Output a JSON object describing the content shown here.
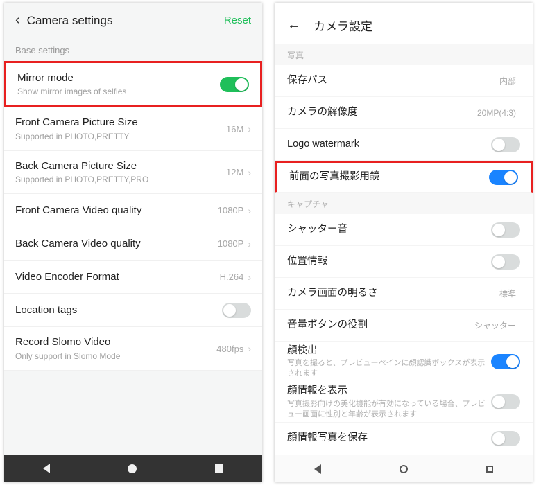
{
  "left": {
    "header": {
      "title": "Camera settings",
      "reset": "Reset"
    },
    "section": "Base settings",
    "rows": {
      "mirror": {
        "title": "Mirror mode",
        "sub": "Show mirror images of selfies"
      },
      "front_size": {
        "title": "Front Camera Picture Size",
        "sub": "Supported in PHOTO,PRETTY",
        "value": "16M"
      },
      "back_size": {
        "title": "Back Camera Picture Size",
        "sub": "Supported in PHOTO,PRETTY,PRO",
        "value": "12M"
      },
      "front_video": {
        "title": "Front Camera Video quality",
        "value": "1080P"
      },
      "back_video": {
        "title": "Back Camera Video quality",
        "value": "1080P"
      },
      "encoder": {
        "title": "Video Encoder Format",
        "value": "H.264"
      },
      "location": {
        "title": "Location tags"
      },
      "slomo": {
        "title": "Record Slomo Video",
        "sub": "Only support in Slomo Mode",
        "value": "480fps"
      }
    }
  },
  "right": {
    "header": {
      "title": "カメラ設定"
    },
    "sec_photo": "写真",
    "sec_capture": "キャプチャ",
    "rows": {
      "save_path": {
        "title": "保存パス",
        "value": "内部"
      },
      "resolution": {
        "title": "カメラの解像度",
        "value": "20MP(4:3)"
      },
      "watermark": {
        "title": "Logo watermark"
      },
      "mirror": {
        "title": "前面の写真撮影用鏡"
      },
      "shutter": {
        "title": "シャッター音"
      },
      "location": {
        "title": "位置情報"
      },
      "brightness": {
        "title": "カメラ画面の明るさ",
        "value": "標準"
      },
      "volume": {
        "title": "音量ボタンの役割",
        "value": "シャッター"
      },
      "face_detect": {
        "title": "顔検出",
        "sub": "写真を撮ると、プレビューペインに顔認識ボックスが表示されます"
      },
      "face_info": {
        "title": "顔情報を表示",
        "sub": "写真撮影向けの美化機能が有効になっている場合、プレビュー画面に性別と年齢が表示されます"
      },
      "face_save": {
        "title": "顔情報写真を保存"
      }
    }
  }
}
